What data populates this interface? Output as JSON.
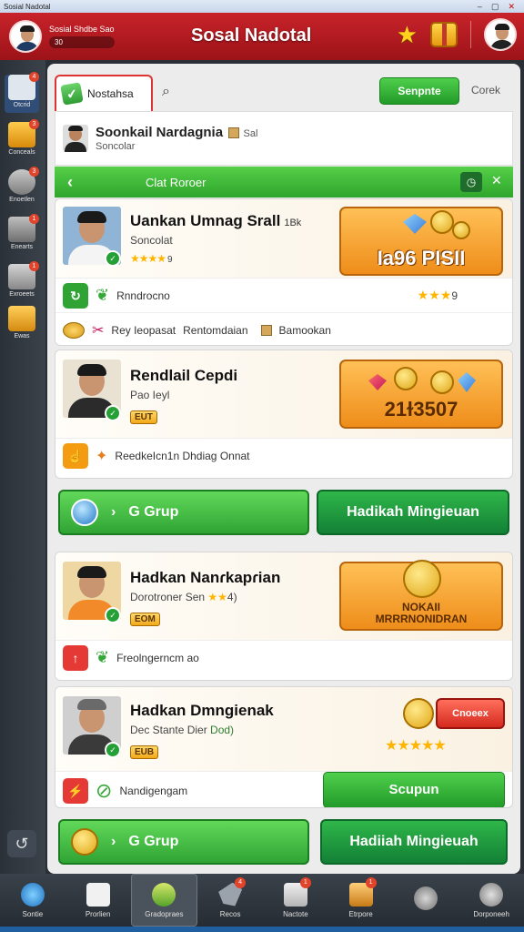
{
  "window": {
    "title": "Sosial Nadotal",
    "controls": [
      "–",
      "▢",
      "✕"
    ]
  },
  "topbar": {
    "user_name": "Sosial Shdbe Sao",
    "coin_text": "30",
    "app_title": "Sosal Nadotal"
  },
  "sidebar": {
    "items": [
      {
        "label": "Otcrid",
        "badge": "4"
      },
      {
        "label": "Conceals",
        "badge": "3"
      },
      {
        "label": "Enoetlen",
        "badge": "3"
      },
      {
        "label": "Enearts",
        "badge": "1"
      },
      {
        "label": "Exroeets",
        "badge": "1"
      },
      {
        "label": "Ewas",
        "badge": ""
      }
    ]
  },
  "tabs": {
    "active_label": "Nostahsa",
    "primary_button": "Senpnte",
    "secondary_button": "Corek"
  },
  "profile": {
    "name": "Soonkail Nardagnia",
    "tag": "Sal",
    "sub": "Soncolar"
  },
  "section": {
    "title": "Clat Roroer"
  },
  "cards": [
    {
      "name": "Uankan Umnag Srall",
      "name_extra": "1Bk",
      "sub": "Soncolat",
      "stars": "★★★★",
      "rating_num": "9",
      "prize_text": "Ia96 PISII",
      "row1_text": "Rnndrocno",
      "row1_stars": "★★★",
      "row1_num": "9",
      "row2_a": "Rey Ieopasat",
      "row2_b": "Rentomdaian",
      "row2_c": "Bamookan"
    },
    {
      "name": "Rendlail Cepdi",
      "sub": "Pao Ieyl",
      "badge": "EUT",
      "prize_text": "21ɫ3507",
      "row1_text": "ReedkeIcn1n Dhdiag Onnat"
    },
    {
      "name": "Hadkan Nanɾkapɾian",
      "sub": "Dorotroner Sen",
      "stars": "★★",
      "rating_num": "4)",
      "badge": "EOM",
      "prize_text": "NOKAII MRRRNONIDRAN",
      "row1_text": "Freolngerncm ao"
    },
    {
      "name": "Hadkan Dmngienak",
      "sub": "Dec Stante Dier",
      "sub_extra": "Dod)",
      "badge": "EUB",
      "stars": "★★★★★",
      "claim_button": "Cnoeex",
      "row1_text": "Nandigengam",
      "row1_button": "Scupun"
    }
  ],
  "buttons": {
    "group1": "G Grup",
    "gift1": "Hadikah Mingieuan",
    "group2": "G Grup",
    "gift2": "Hadiiah Mingieuah"
  },
  "bottomnav": [
    {
      "label": "Sontie",
      "badge": ""
    },
    {
      "label": "Prorlien",
      "badge": ""
    },
    {
      "label": "Gradopraes",
      "badge": ""
    },
    {
      "label": "Recos",
      "badge": "4"
    },
    {
      "label": "Nactote",
      "badge": "1"
    },
    {
      "label": "Etrpore",
      "badge": "1"
    },
    {
      "label": "",
      "badge": ""
    },
    {
      "label": "Dorponeeh",
      "badge": ""
    }
  ],
  "colors": {
    "brand_red": "#b8191f",
    "accent_green": "#2fa434",
    "prize_orange": "#ee8d1a"
  }
}
